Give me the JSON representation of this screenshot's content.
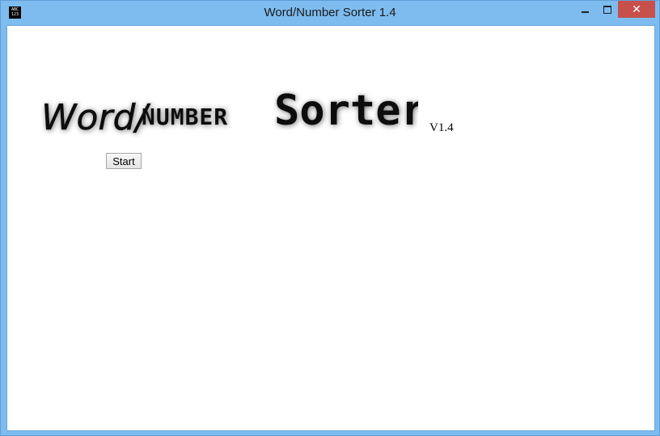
{
  "window": {
    "title": "Word/Number Sorter 1.4",
    "icon": "abc-123-icon",
    "icon_lines": [
      "ABC",
      "123"
    ]
  },
  "controls": {
    "minimize_icon": "minimize-icon",
    "maximize_icon": "maximize-icon",
    "close_icon": "close-icon",
    "close_color": "#c7504c"
  },
  "logo": {
    "word": "Word/",
    "number": "NUMBER",
    "sorter": "Sorter"
  },
  "version": "V1.4",
  "start_button": "Start"
}
